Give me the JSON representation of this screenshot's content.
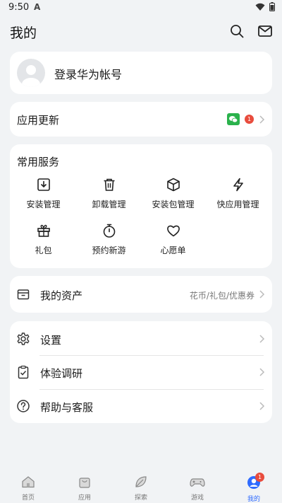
{
  "status": {
    "time": "9:50",
    "badge_letter": "A"
  },
  "header": {
    "title": "我的"
  },
  "login": {
    "label": "登录华为帐号"
  },
  "update": {
    "label": "应用更新",
    "badge_count": "1"
  },
  "services": {
    "title": "常用服务",
    "items": [
      {
        "label": "安装管理",
        "icon": "download-box-icon"
      },
      {
        "label": "卸载管理",
        "icon": "trash-icon"
      },
      {
        "label": "安装包管理",
        "icon": "package-icon"
      },
      {
        "label": "快应用管理",
        "icon": "flash-icon"
      },
      {
        "label": "礼包",
        "icon": "gift-icon"
      },
      {
        "label": "预约新游",
        "icon": "stopwatch-icon"
      },
      {
        "label": "心愿单",
        "icon": "heart-icon"
      }
    ]
  },
  "assets": {
    "label": "我的资产",
    "detail": "花币/礼包/优惠券"
  },
  "menu": [
    {
      "label": "设置",
      "icon": "gear-icon"
    },
    {
      "label": "体验调研",
      "icon": "clipboard-icon"
    },
    {
      "label": "帮助与客服",
      "icon": "help-icon"
    }
  ],
  "nav": [
    {
      "label": "首页",
      "icon": "home-icon"
    },
    {
      "label": "应用",
      "icon": "bag-icon"
    },
    {
      "label": "探索",
      "icon": "leaf-icon"
    },
    {
      "label": "游戏",
      "icon": "gamepad-icon"
    },
    {
      "label": "我的",
      "icon": "profile-icon",
      "badge": "1"
    }
  ],
  "colors": {
    "badge_red": "#e84c3d",
    "wechat_green": "#2bb24c",
    "accent_blue": "#2f6bff"
  }
}
